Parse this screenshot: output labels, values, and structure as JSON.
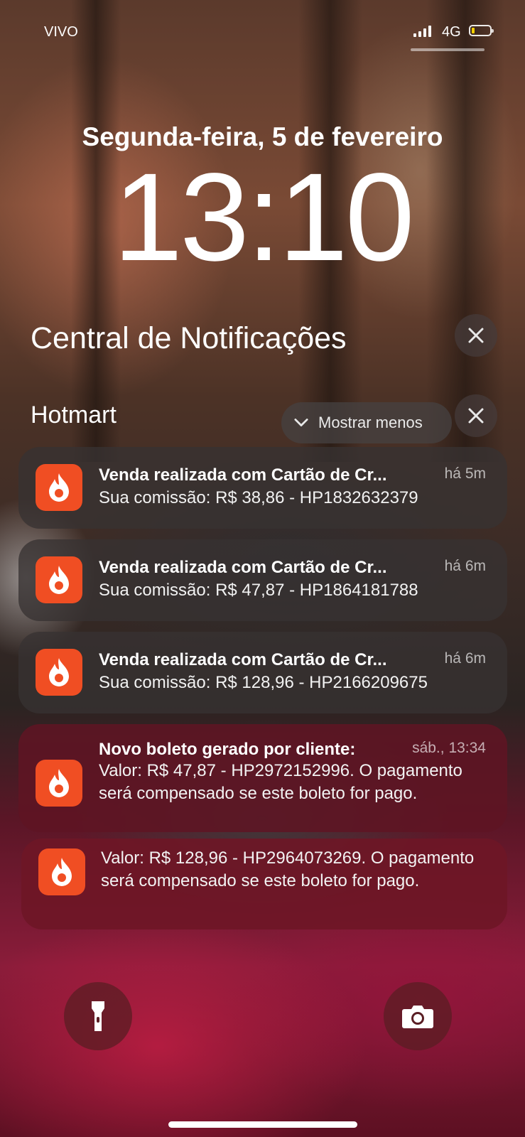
{
  "status_bar": {
    "carrier": "VIVO",
    "network": "4G",
    "battery_level": 0.1,
    "battery_color": "#f5d000"
  },
  "lock": {
    "date": "Segunda-feira, 5 de fevereiro",
    "time": "13:10"
  },
  "notification_center": {
    "title": "Central de Notificações"
  },
  "group": {
    "app_name": "Hotmart",
    "show_less_label": "Mostrar menos"
  },
  "notifications": [
    {
      "title": "Venda realizada com Cartão de Cr...",
      "body": "Sua comissão: R$ 38,86 - HP1832632379",
      "time": "há 5m"
    },
    {
      "title": "Venda realizada com Cartão de Cr...",
      "body": "Sua comissão: R$ 47,87 - HP1864181788",
      "time": "há 6m"
    },
    {
      "title": "Venda realizada com Cartão de Cr...",
      "body": "Sua comissão: R$ 128,96 - HP2166209675",
      "time": "há 6m"
    },
    {
      "title": "Novo boleto gerado por cliente:",
      "body": "Valor: R$ 47,87 - HP2972152996. O pagamento será compensado se este boleto for pago.",
      "time": "sáb., 13:34"
    },
    {
      "title": "",
      "body": "Valor: R$ 128,96 - HP2964073269. O pagamento será compensado se este boleto for pago.",
      "time": ""
    }
  ],
  "colors": {
    "app_icon": "#f04e23"
  },
  "icons": {
    "close": "close-icon",
    "chevron": "chevron-down-icon",
    "flashlight": "flashlight-icon",
    "camera": "camera-icon",
    "app": "hotmart-flame-icon"
  }
}
